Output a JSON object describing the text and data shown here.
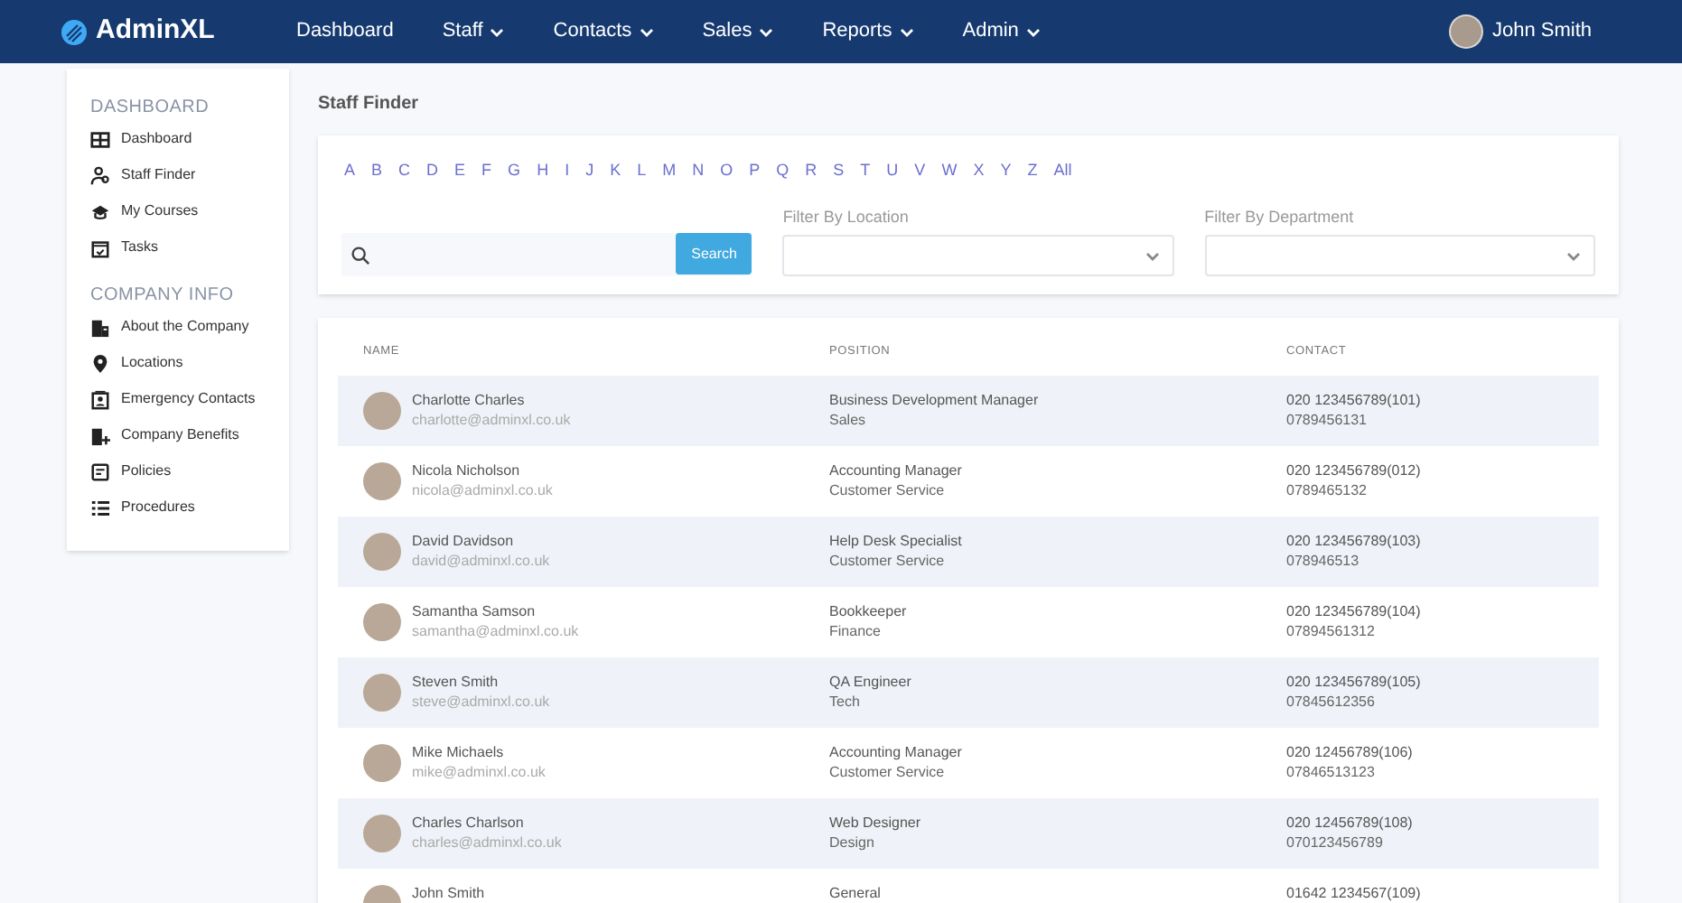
{
  "brand": "AdminXL",
  "nav": [
    {
      "label": "Dashboard",
      "dropdown": false
    },
    {
      "label": "Staff",
      "dropdown": true
    },
    {
      "label": "Contacts",
      "dropdown": true
    },
    {
      "label": "Sales",
      "dropdown": true
    },
    {
      "label": "Reports",
      "dropdown": true
    },
    {
      "label": "Admin",
      "dropdown": true
    }
  ],
  "user": {
    "name": "John Smith"
  },
  "sidebar": [
    {
      "heading": "DASHBOARD",
      "items": [
        {
          "label": "Dashboard"
        },
        {
          "label": "Staff Finder"
        },
        {
          "label": "My Courses"
        },
        {
          "label": "Tasks"
        }
      ]
    },
    {
      "heading": "COMPANY INFO",
      "items": [
        {
          "label": "About the Company"
        },
        {
          "label": "Locations"
        },
        {
          "label": "Emergency Contacts"
        },
        {
          "label": "Company Benefits"
        },
        {
          "label": "Policies"
        },
        {
          "label": "Procedures"
        }
      ]
    }
  ],
  "page_title": "Staff Finder",
  "letters": [
    "A",
    "B",
    "C",
    "D",
    "E",
    "F",
    "G",
    "H",
    "I",
    "J",
    "K",
    "L",
    "M",
    "N",
    "O",
    "P",
    "Q",
    "R",
    "S",
    "T",
    "U",
    "V",
    "W",
    "X",
    "Y",
    "Z",
    "All"
  ],
  "search_button": "Search",
  "filters": [
    {
      "label": "Filter By Location"
    },
    {
      "label": "Filter By Department"
    }
  ],
  "table": {
    "columns": [
      "NAME",
      "POSITION",
      "CONTACT"
    ],
    "rows": [
      {
        "name": "Charlotte Charles",
        "email": "charlotte@adminxl.co.uk",
        "position": "Business Development Manager",
        "department": "Sales",
        "phone": "020 123456789(101)",
        "mobile": "0789456131"
      },
      {
        "name": "Nicola Nicholson",
        "email": "nicola@adminxl.co.uk",
        "position": "Accounting Manager",
        "department": "Customer Service",
        "phone": "020 123456789(012)",
        "mobile": "0789465132"
      },
      {
        "name": "David Davidson",
        "email": "david@adminxl.co.uk",
        "position": "Help Desk Specialist",
        "department": "Customer Service",
        "phone": "020 123456789(103)",
        "mobile": "078946513"
      },
      {
        "name": "Samantha Samson",
        "email": "samantha@adminxl.co.uk",
        "position": "Bookkeeper",
        "department": "Finance",
        "phone": "020 123456789(104)",
        "mobile": "07894561312"
      },
      {
        "name": "Steven Smith",
        "email": "steve@adminxl.co.uk",
        "position": "QA Engineer",
        "department": "Tech",
        "phone": "020 123456789(105)",
        "mobile": "07845612356"
      },
      {
        "name": "Mike Michaels",
        "email": "mike@adminxl.co.uk",
        "position": "Accounting Manager",
        "department": "Customer Service",
        "phone": "020 12456789(106)",
        "mobile": "07846513123"
      },
      {
        "name": "Charles Charlson",
        "email": "charles@adminxl.co.uk",
        "position": "Web Designer",
        "department": "Design",
        "phone": "020 12456789(108)",
        "mobile": "070123456789"
      },
      {
        "name": "John Smith",
        "position": "General",
        "phone": "01642 1234567(109)"
      }
    ]
  }
}
